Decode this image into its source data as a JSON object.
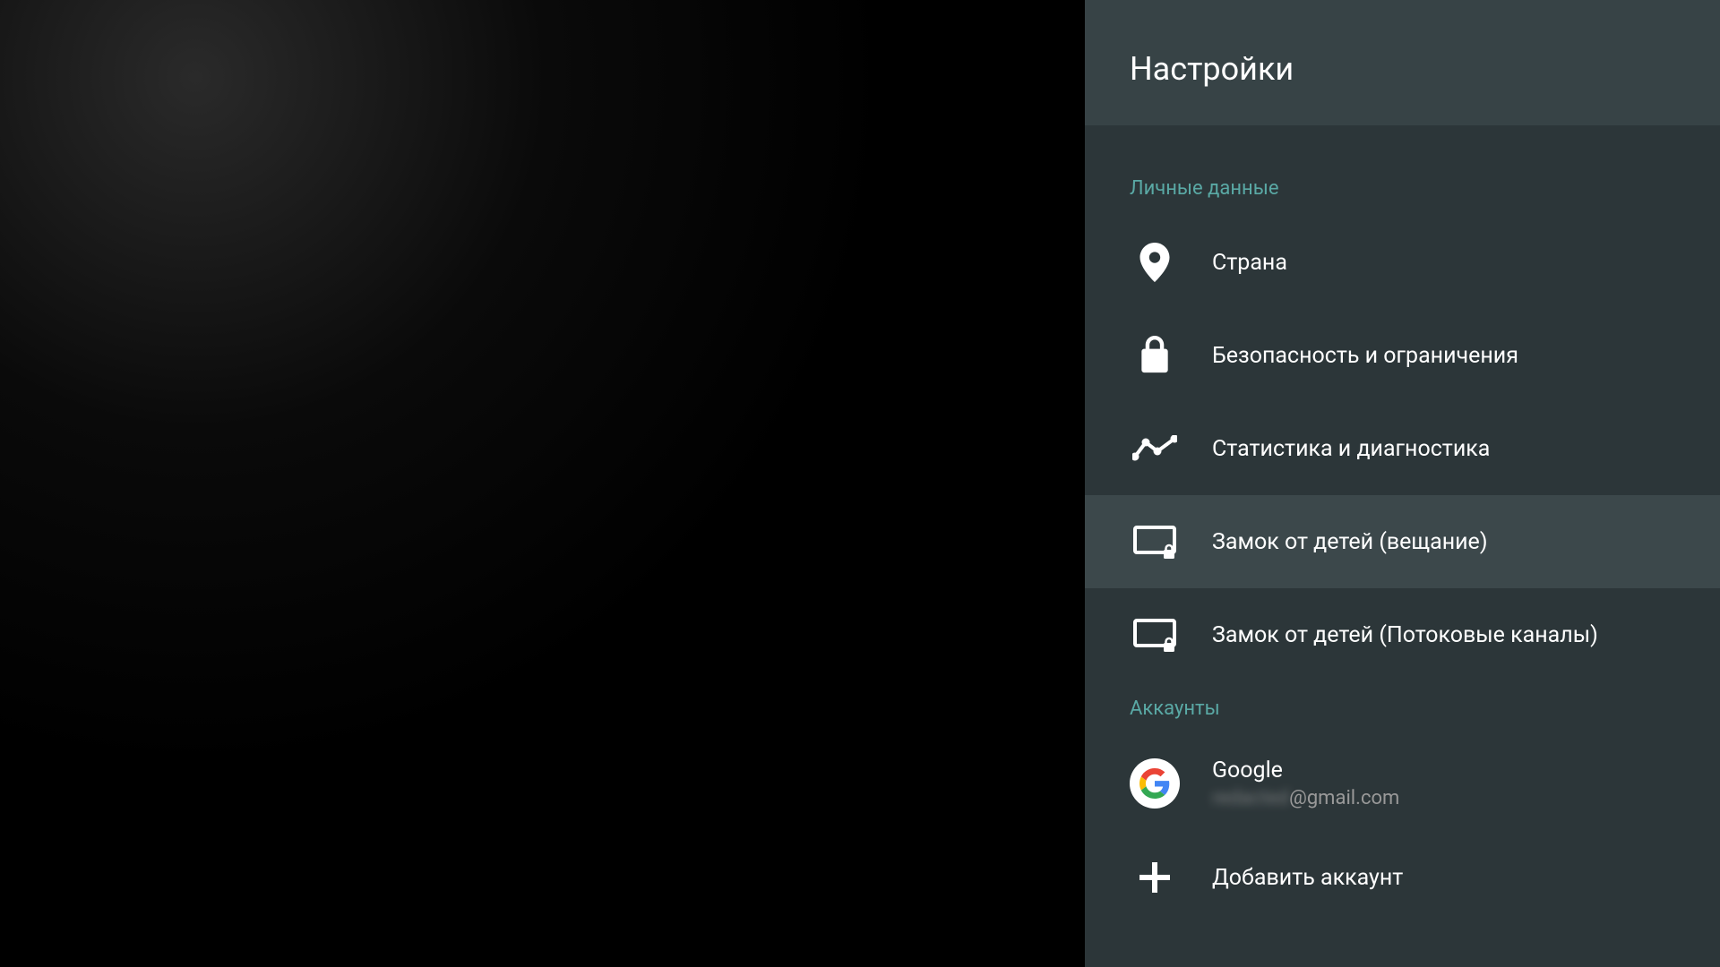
{
  "panel": {
    "title": "Настройки"
  },
  "sections": {
    "personal": {
      "header": "Личные данные",
      "items": {
        "country": "Страна",
        "security": "Безопасность и ограничения",
        "stats": "Статистика и диагностика",
        "childLockBroadcast": "Замок от детей (вещание)",
        "childLockStreaming": "Замок от детей (Потоковые каналы)"
      }
    },
    "accounts": {
      "header": "Аккаунты",
      "items": {
        "google": {
          "label": "Google",
          "email_user": "redacted",
          "email_domain": "@gmail.com"
        },
        "addAccount": "Добавить аккаунт"
      }
    }
  }
}
